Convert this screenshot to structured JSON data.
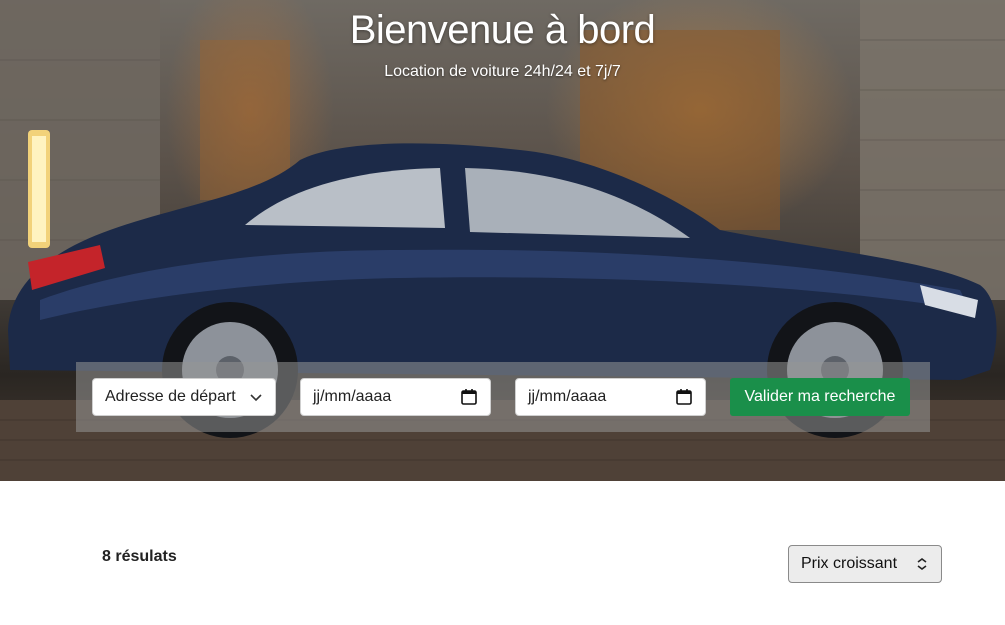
{
  "hero": {
    "title": "Bienvenue à bord",
    "subtitle": "Location de voiture 24h/24 et 7j/7"
  },
  "search": {
    "departure_select": "Adresse de départ",
    "start_date_placeholder": "jj/mm/aaaa",
    "end_date_placeholder": "jj/mm/aaaa",
    "submit_label": "Valider ma recherche",
    "accent_color": "#1a8f4a"
  },
  "results": {
    "count_label": "8 résulats",
    "sort_selected": "Prix croissant"
  },
  "icons": {
    "select_chevron": "chevron-down-icon",
    "date_picker": "calendar-icon",
    "sort_chevron": "chevron-updown-icon"
  }
}
